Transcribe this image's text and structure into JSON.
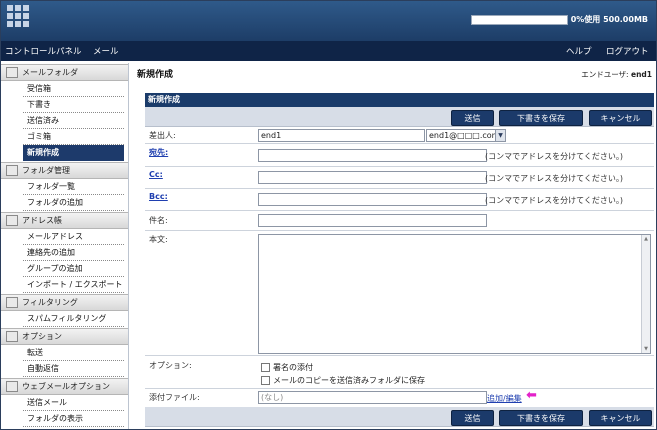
{
  "header": {
    "quota_fill": 0.0,
    "quota_text": "0%使用 500.00MB"
  },
  "nav": {
    "control_panel": "コントロールパネル",
    "mail": "メール",
    "help": "ヘルプ",
    "logout": "ログアウト"
  },
  "sidebar": {
    "sections": [
      {
        "title": "メールフォルダ",
        "items": [
          "受信箱",
          "下書き",
          "送信済み",
          "ゴミ箱",
          "新規作成"
        ]
      },
      {
        "title": "フォルダ管理",
        "items": [
          "フォルダ一覧",
          "フォルダの追加"
        ]
      },
      {
        "title": "アドレス帳",
        "items": [
          "メールアドレス",
          "連絡先の追加",
          "グループの追加",
          "インポート / エクスポート"
        ]
      },
      {
        "title": "フィルタリング",
        "items": [
          "スパムフィルタリング"
        ]
      },
      {
        "title": "オプション",
        "items": [
          "転送",
          "自動返信"
        ]
      },
      {
        "title": "ウェブメールオプション",
        "items": [
          "送信メール",
          "フォルダの表示"
        ]
      }
    ],
    "active_item": "新規作成"
  },
  "main": {
    "page_title": "新規作成",
    "end_user_label": "エンドユーザ:",
    "end_user": "end1",
    "panel_title": "新規作成",
    "buttons": {
      "send": "送信",
      "save_draft": "下書きを保存",
      "cancel": "キャンセル"
    },
    "form": {
      "from_label": "差出人:",
      "from_value": "end1",
      "from_domain": "end1@□□□.com",
      "to_label": "宛先:",
      "cc_label": "Cc:",
      "bcc_label": "Bcc:",
      "address_hint": "(コンマでアドレスを分けてください。)",
      "subject_label": "件名:",
      "body_label": "本文:",
      "options_label": "オプション:",
      "option_signature": "署名の添付",
      "option_copy": "メールのコピーを送信済みフォルダに保存",
      "attachment_label": "添付ファイル:",
      "attachment_value": "(なし)",
      "attachment_edit": "追加/編集"
    }
  }
}
